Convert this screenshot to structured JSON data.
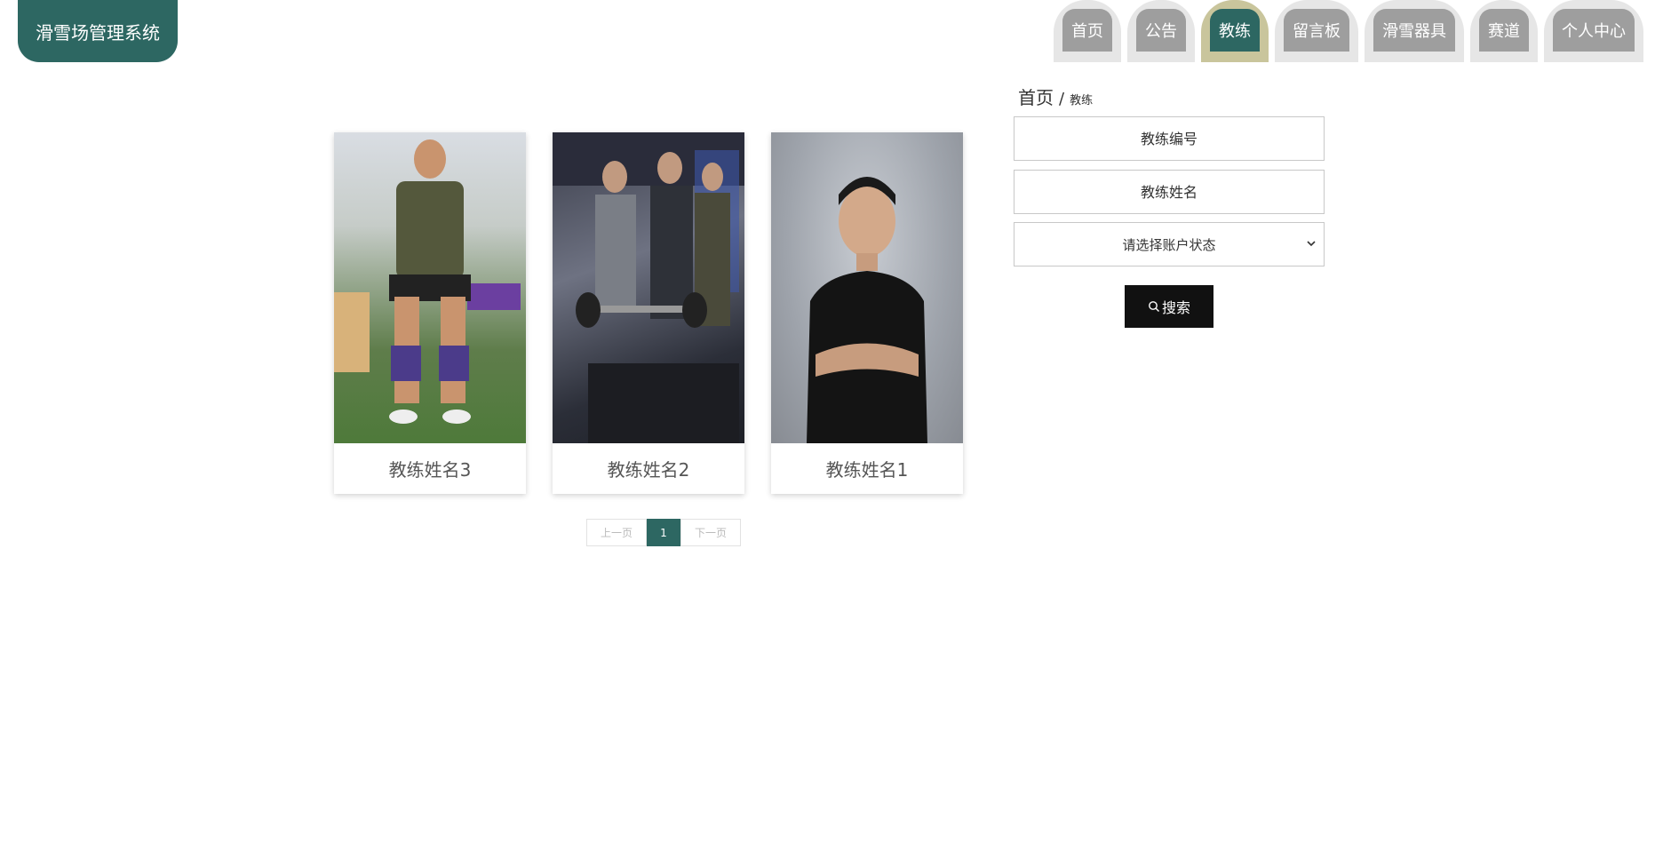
{
  "app": {
    "title": "滑雪场管理系统"
  },
  "nav": {
    "items": [
      {
        "label": "首页"
      },
      {
        "label": "公告"
      },
      {
        "label": "教练"
      },
      {
        "label": "留言板"
      },
      {
        "label": "滑雪器具"
      },
      {
        "label": "赛道"
      },
      {
        "label": "个人中心"
      }
    ],
    "active_index": 2
  },
  "breadcrumb": {
    "home": "首页",
    "separator": "/",
    "current": "教练"
  },
  "cards": [
    {
      "name": "教练姓名3"
    },
    {
      "name": "教练姓名2"
    },
    {
      "name": "教练姓名1"
    }
  ],
  "pagination": {
    "prev": "上一页",
    "current": "1",
    "next": "下一页"
  },
  "search": {
    "coach_no_placeholder": "教练编号",
    "coach_name_placeholder": "教练姓名",
    "status_select": "请选择账户状态",
    "button_label": "搜索"
  },
  "colors": {
    "accent": "#2d6762",
    "nav_active_border": "#c9c59c",
    "nav_tab": "#9e9e9e",
    "button": "#111111"
  }
}
